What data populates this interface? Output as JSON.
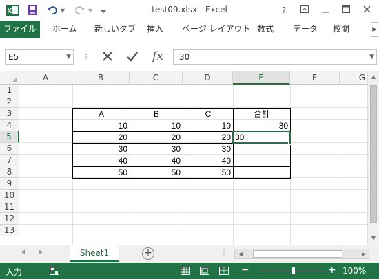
{
  "window": {
    "title": "test09.xlsx - Excel",
    "controls": {
      "help": "?",
      "restore_ribbon": "⊼",
      "minimize": "—",
      "maximize": "☐",
      "close": "✕"
    }
  },
  "quick_access": {
    "icons": [
      "excel-logo-icon",
      "save-icon",
      "undo-icon",
      "redo-icon",
      "customize-icon"
    ],
    "app_letter": "X"
  },
  "ribbon": {
    "file_tab": "ファイル",
    "tabs": [
      "ホーム",
      "新しいタブ",
      "挿入",
      "ページ レイアウト",
      "数式",
      "データ",
      "校閲"
    ],
    "scroll": "▶",
    "accent_color": "#217346"
  },
  "formula_bar": {
    "name_box": "E5",
    "cancel_glyph": "✕",
    "enter_glyph": "✔",
    "fx_label": "fx",
    "content": "30"
  },
  "grid": {
    "columns": [
      "A",
      "B",
      "C",
      "D",
      "E",
      "F",
      "G"
    ],
    "selected_column": "E",
    "rows": [
      "1",
      "2",
      "3",
      "4",
      "5",
      "6",
      "7",
      "8",
      "9",
      "10",
      "11",
      "12",
      "13"
    ],
    "selected_row": "5",
    "table": {
      "headers": [
        "A",
        "B",
        "C",
        "合計"
      ],
      "data": [
        [
          "10",
          "10",
          "10",
          "30"
        ],
        [
          "20",
          "20",
          "20",
          "30"
        ],
        [
          "30",
          "30",
          "30",
          ""
        ],
        [
          "40",
          "40",
          "40",
          ""
        ],
        [
          "50",
          "50",
          "50",
          ""
        ]
      ]
    },
    "active_cell": "E5"
  },
  "sheets": {
    "tabs": [
      "Sheet1"
    ],
    "active": "Sheet1",
    "add_label": "+",
    "nav_prev": "◀",
    "nav_next": "▶",
    "hscroll_more": "⋮"
  },
  "status_bar": {
    "mode": "入力",
    "zoom": "100%",
    "zoom_minus": "−",
    "zoom_plus": "+"
  }
}
